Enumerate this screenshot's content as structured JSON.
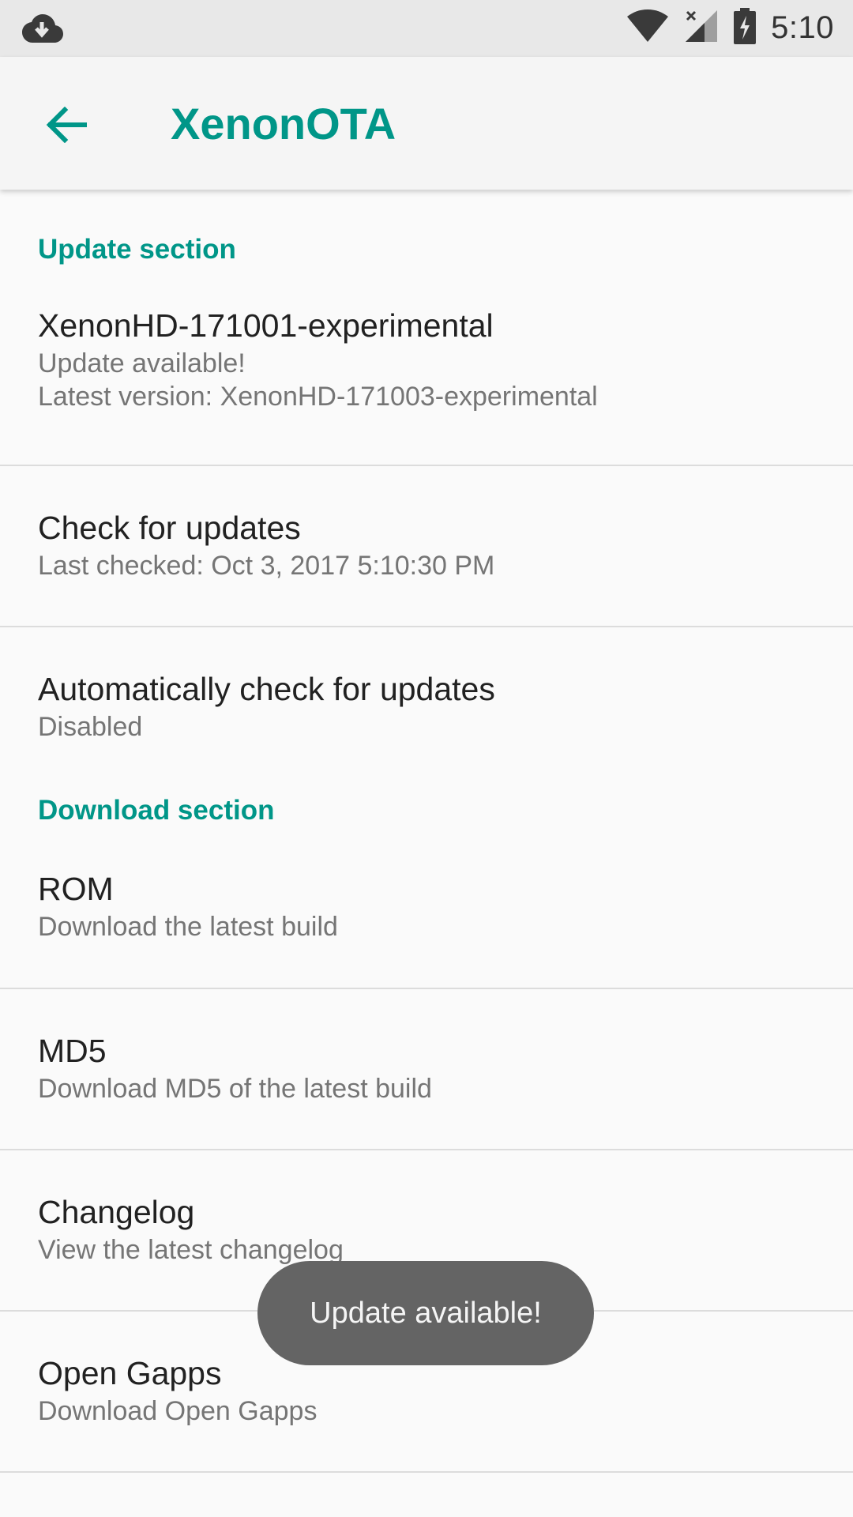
{
  "status_bar": {
    "time": "5:10",
    "icons": [
      "download-icon",
      "wifi-icon",
      "signal-icon",
      "battery-charging-icon"
    ]
  },
  "app_bar": {
    "title": "XenonOTA",
    "back_icon": "arrow-back-icon"
  },
  "colors": {
    "accent": "#009688",
    "toast_bg": "#646464"
  },
  "sections": {
    "update": {
      "header": "Update section",
      "items": [
        {
          "title": "XenonHD-171001-experimental",
          "summary_line1": "Update available!",
          "summary_line2": "Latest version: XenonHD-171003-experimental"
        },
        {
          "title": "Check for updates",
          "summary": "Last checked: Oct 3, 2017 5:10:30 PM"
        },
        {
          "title": "Automatically check for updates",
          "summary": "Disabled"
        }
      ]
    },
    "download": {
      "header": "Download section",
      "items": [
        {
          "title": "ROM",
          "summary": "Download the latest build"
        },
        {
          "title": "MD5",
          "summary": "Download MD5 of the latest build"
        },
        {
          "title": "Changelog",
          "summary": "View the latest changelog"
        },
        {
          "title": "Open Gapps",
          "summary": "Download Open Gapps"
        }
      ]
    }
  },
  "toast": {
    "text": "Update available!"
  }
}
